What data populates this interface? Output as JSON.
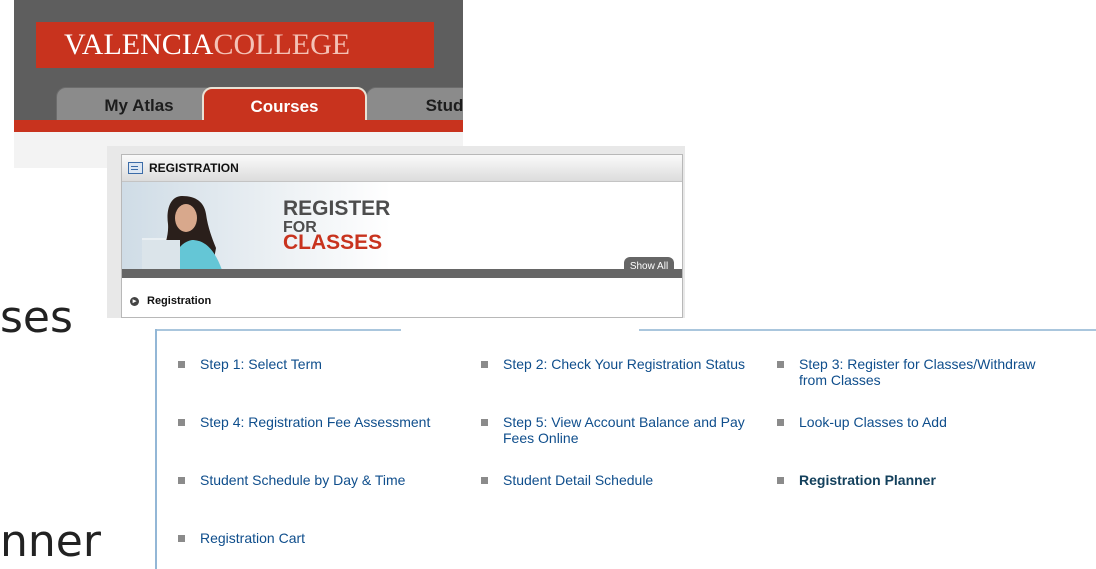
{
  "background": {
    "text_fragment_1": "ses",
    "text_fragment_2": "nner"
  },
  "header": {
    "logo": {
      "valencia": "VALENCIA",
      "college": "COLLEGE"
    },
    "tabs": [
      {
        "label": "My Atlas"
      },
      {
        "label": "Courses",
        "active": true
      },
      {
        "label": "Studer"
      }
    ],
    "colors": {
      "brand": "#c8331e",
      "tabbar": "#5e5e5e"
    }
  },
  "registration_channel": {
    "title": "REGISTRATION",
    "banner": {
      "line1": "REGISTER",
      "line2": "FOR",
      "line3": "CLASSES"
    },
    "show_all_label": "Show All",
    "link_label": "Registration"
  },
  "steps": {
    "items": [
      {
        "label": "Step 1: Select Term"
      },
      {
        "label": "Step 2: Check Your Registration Status"
      },
      {
        "label": "Step 3: Register for Classes/Withdraw from Classes"
      },
      {
        "label": "Step 4: Registration Fee Assessment"
      },
      {
        "label": "Step 5: View Account Balance and Pay Fees Online"
      },
      {
        "label": "Look-up Classes to Add"
      },
      {
        "label": "Student Schedule by Day & Time"
      },
      {
        "label": "Student Detail Schedule"
      },
      {
        "label": "Registration Planner",
        "highlighted": true
      },
      {
        "label": "Registration Cart"
      }
    ],
    "highlight_color": "#fbf73c",
    "link_color": "#0f4e8c"
  }
}
